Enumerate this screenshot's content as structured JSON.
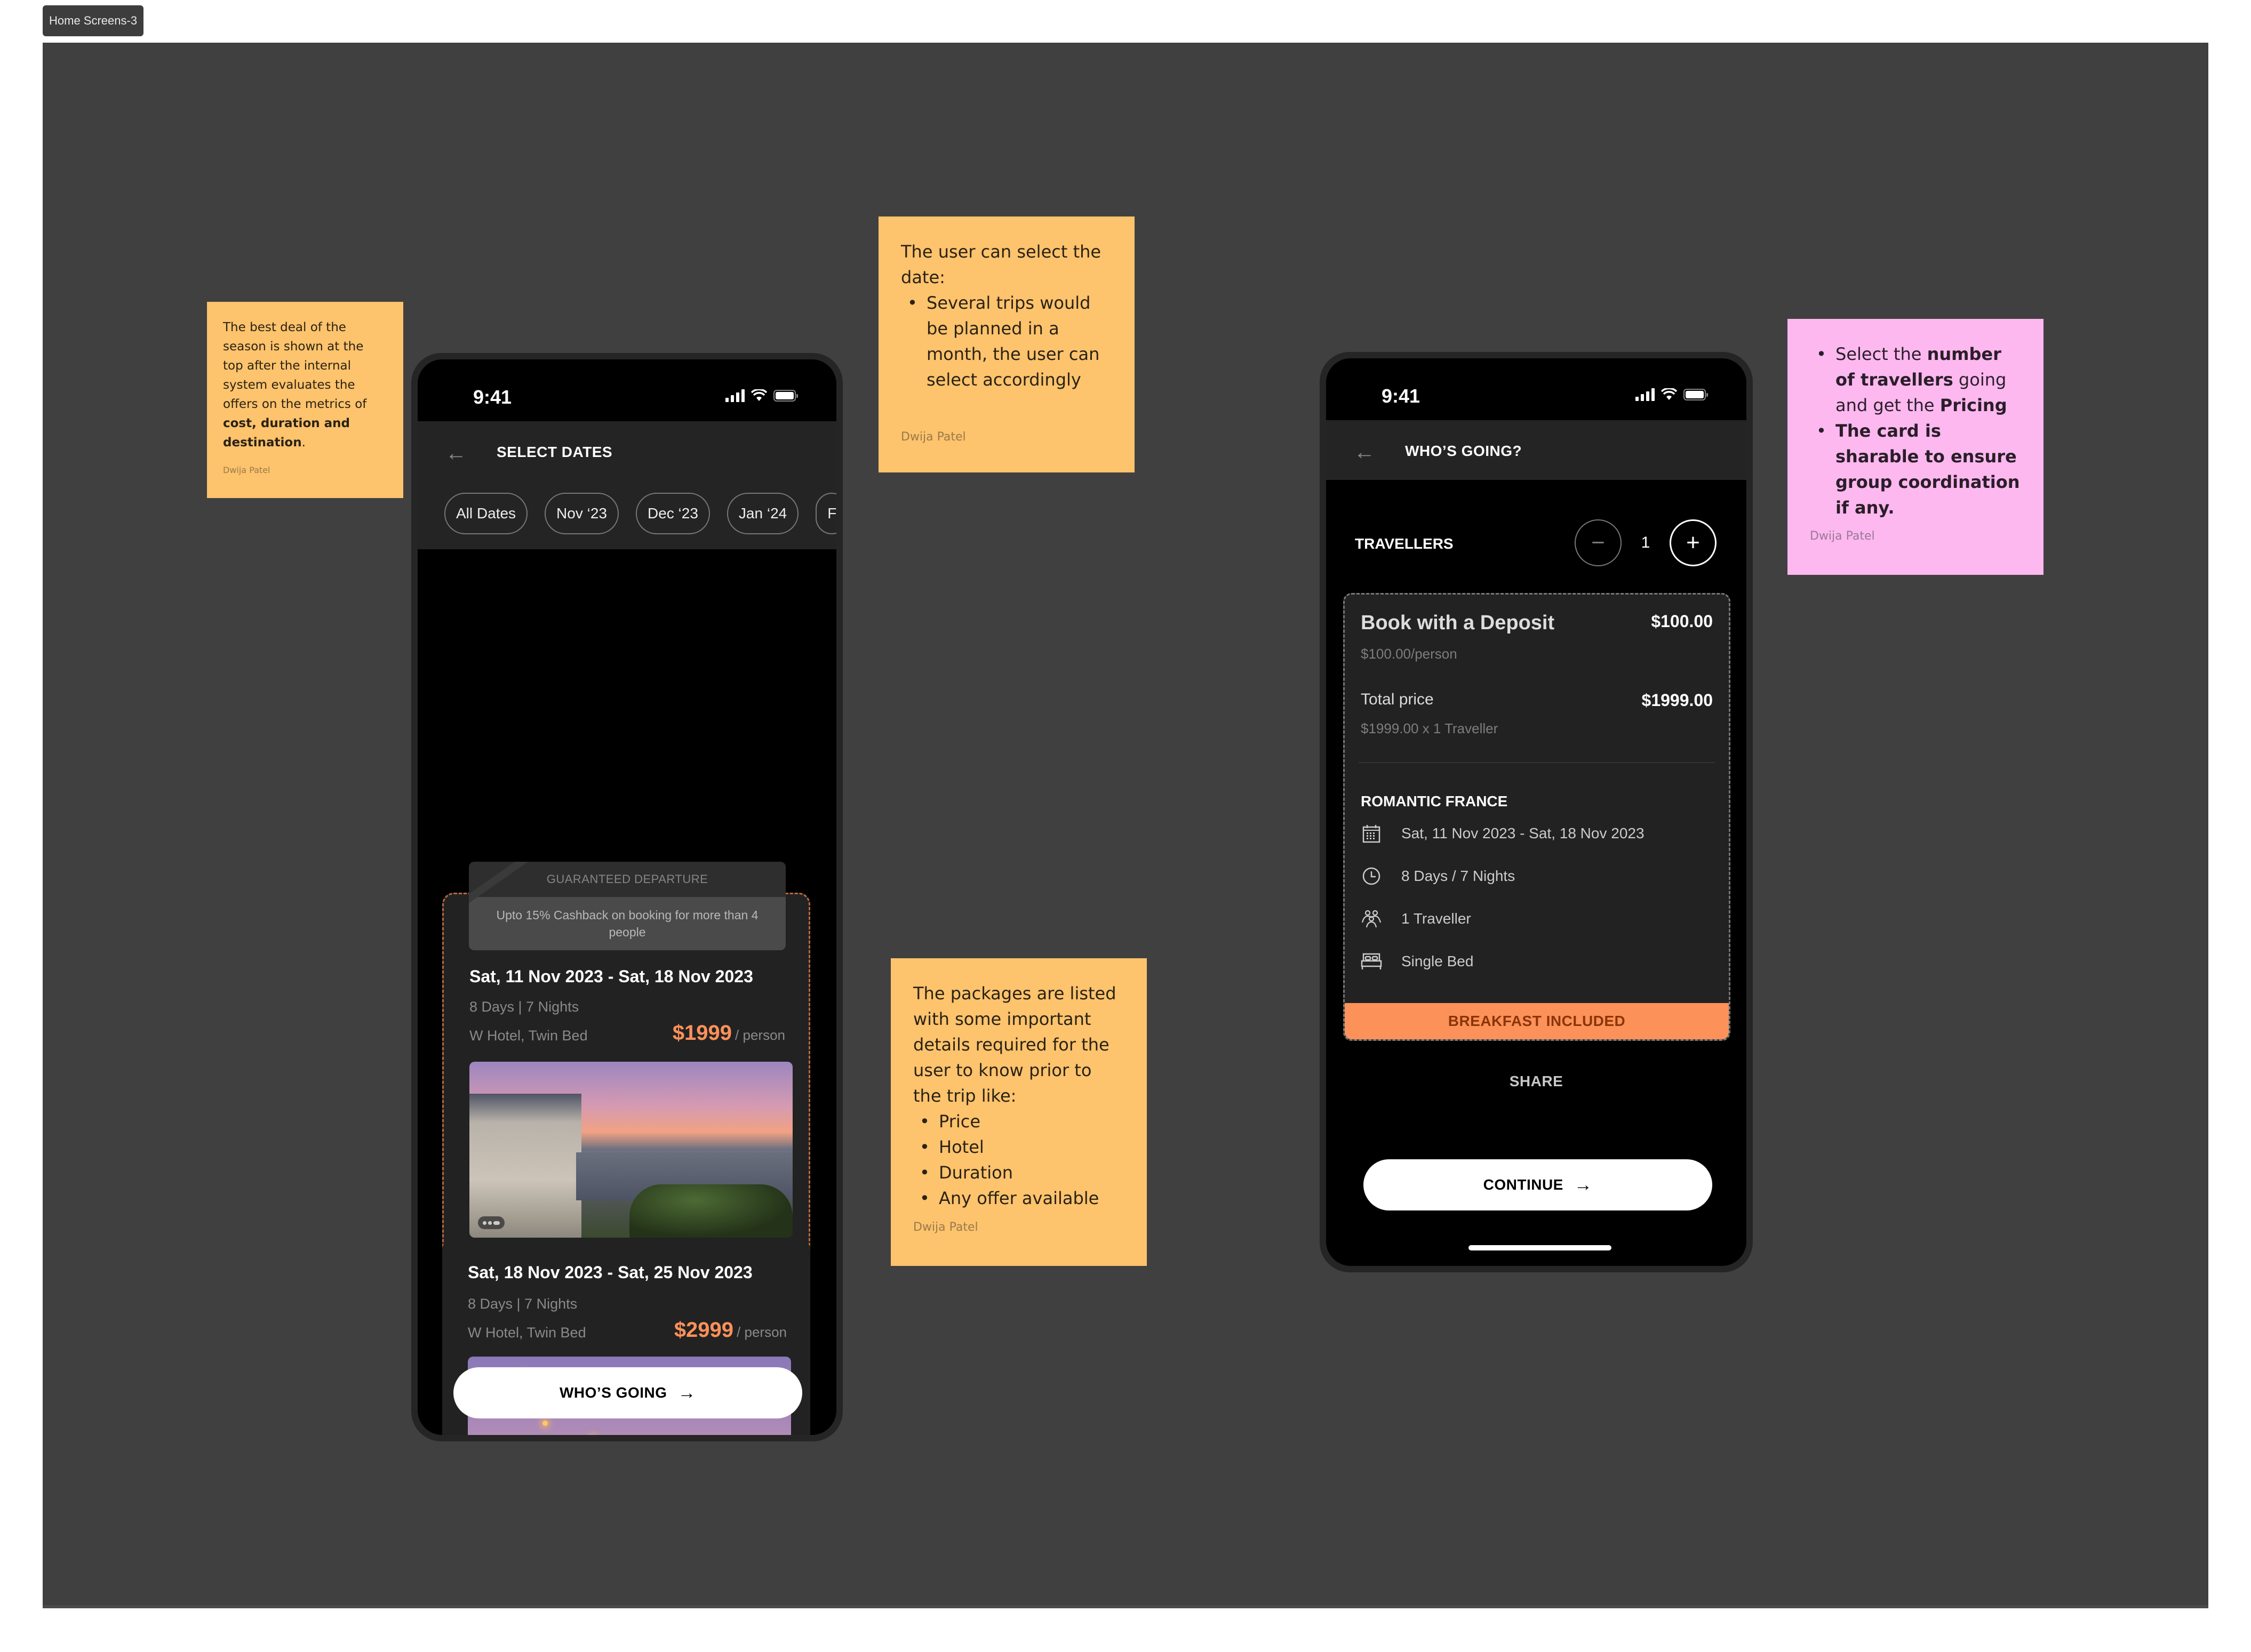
{
  "frame": {
    "label": "Home Screens-3"
  },
  "notes": {
    "best_deal": {
      "text_before": "The best deal of the season is shown at the top after the internal system evaluates the offers on the metrics of ",
      "text_bold": "cost, duration and destination",
      "text_after": ".",
      "author": "Dwija Patel"
    },
    "select_date": {
      "intro": "The user can select the date:",
      "bullets": [
        "Several trips would be planned in a month, the user can select accordingly"
      ],
      "author": "Dwija Patel"
    },
    "packages": {
      "intro": "The packages are listed with some important details required for the user to know prior to the trip like:",
      "bullets": [
        "Price",
        "Hotel",
        "Duration",
        "Any offer available"
      ],
      "author": "Dwija Patel"
    },
    "travellers": {
      "b1_pre": "Select the ",
      "b1_bold1": "number of travellers",
      "b1_mid": " going and get the ",
      "b1_bold2": "Pricing",
      "b2_bold": "The card is sharable to ensure group coordination if any.",
      "author": "Dwija Patel"
    }
  },
  "select_dates_screen": {
    "status_time": "9:41",
    "title": "SELECT DATES",
    "back_icon": "arrow-left-icon",
    "chips": [
      "All Dates",
      "Nov ‘23",
      "Dec ‘23",
      "Jan ‘24",
      "F"
    ],
    "banner": {
      "label": "GUARANTEED DEPARTURE",
      "offer": "Upto 15% Cashback on booking for more than 4 people"
    },
    "trips": [
      {
        "dates": "Sat, 11 Nov 2023 - Sat, 18 Nov 2023",
        "duration": "8 Days | 7 Nights",
        "hotel": "W Hotel, Twin Bed",
        "price": "$1999",
        "per": "/ person",
        "image": "paris-rooftops-sunset"
      },
      {
        "dates": "Sat, 18 Nov 2023 - Sat, 25 Nov 2023",
        "duration": "8 Days | 7 Nights",
        "hotel": "W Hotel, Twin Bed",
        "price": "$2999",
        "per": "/ person",
        "image": "pont-alexandre-iii-dusk"
      }
    ],
    "cta": "WHO’S GOING",
    "cta_icon": "arrow-right-icon"
  },
  "whos_going_screen": {
    "status_time": "9:41",
    "title": "WHO’S GOING?",
    "travellers_label": "TRAVELLERS",
    "traveller_count": "1",
    "card": {
      "deposit_title": "Book with a Deposit",
      "deposit_amount": "$100.00",
      "deposit_sub": "$100.00/person",
      "total_label": "Total price",
      "total_amount": "$1999.00",
      "total_sub": "$1999.00 x 1 Traveller",
      "package_name": "ROMANTIC FRANCE",
      "details": [
        {
          "icon": "calendar-icon",
          "text": "Sat, 11 Nov 2023 - Sat, 18 Nov 2023"
        },
        {
          "icon": "clock-icon",
          "text": "8 Days / 7 Nights"
        },
        {
          "icon": "group-icon",
          "text": "1 Traveller"
        },
        {
          "icon": "bed-icon",
          "text": "Single Bed"
        }
      ],
      "badge": "BREAKFAST INCLUDED"
    },
    "share": "SHARE",
    "cta": "CONTINUE"
  },
  "colors": {
    "accent_orange": "#fd915a",
    "sticky_orange": "#fdc36d",
    "sticky_pink": "#fdb8f0",
    "canvas": "#404040"
  }
}
